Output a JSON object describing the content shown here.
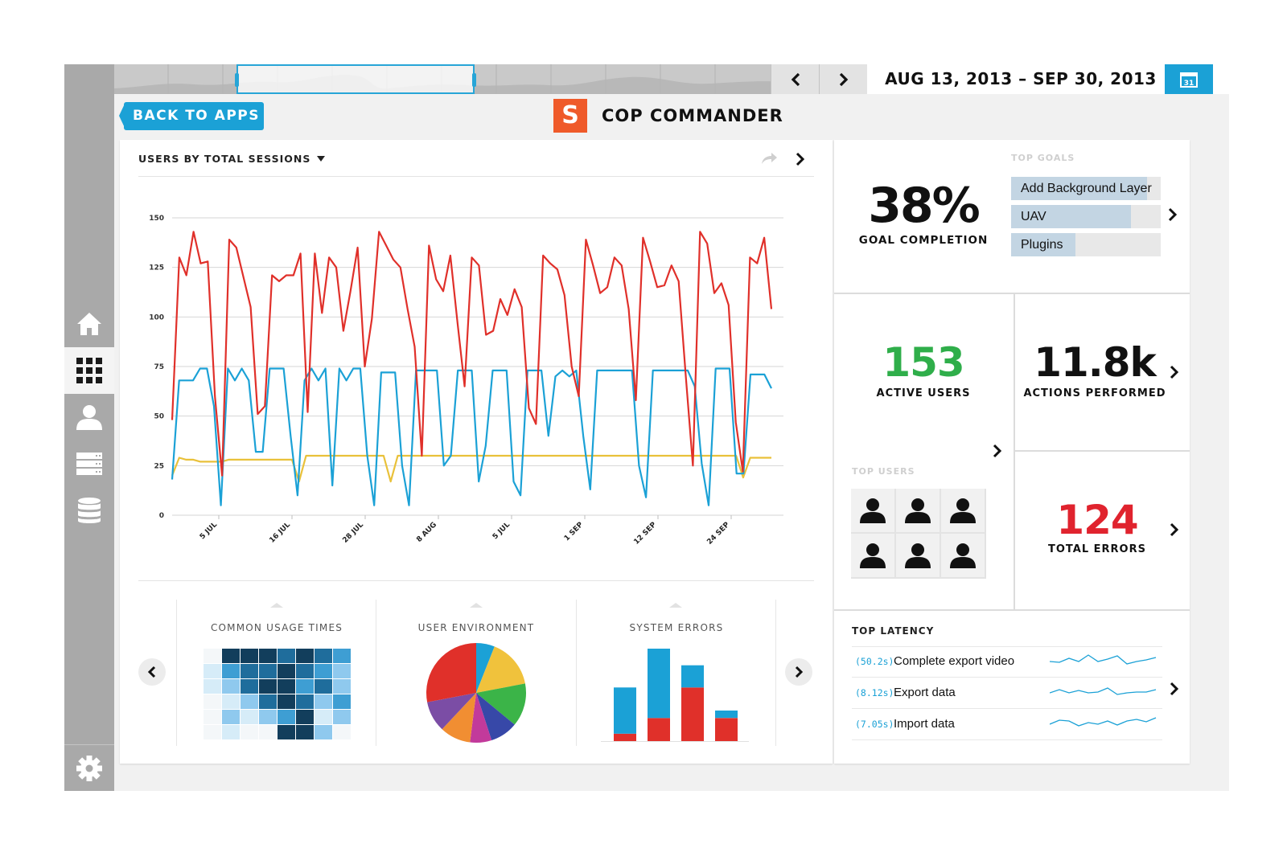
{
  "topbar": {
    "date_range": "AUG 13, 2013 – SEP 30, 2013",
    "calendar_day": "31"
  },
  "header": {
    "back_label": "BACK TO APPS",
    "app_logo_letter": "S",
    "app_title": "COP COMMANDER"
  },
  "sidebar": {
    "items": [
      {
        "icon": "home-icon"
      },
      {
        "icon": "grid-icon",
        "active": true
      },
      {
        "icon": "user-icon"
      },
      {
        "icon": "server-icon"
      },
      {
        "icon": "database-icon"
      }
    ],
    "settings_icon": "gear-icon"
  },
  "main_chart": {
    "title": "USERS BY TOTAL SESSIONS",
    "chart_data": {
      "type": "line",
      "y_ticks": [
        "150",
        "125",
        "100",
        "75",
        "50",
        "25",
        "0"
      ],
      "ylim": [
        0,
        150
      ],
      "x_tick_labels": [
        "5 JUL",
        "16 JUL",
        "28 JUL",
        "8 AUG",
        "5 JUL",
        "1 SEP",
        "12 SEP",
        "24 SEP"
      ],
      "grid": true,
      "colors": [
        "#e0302a",
        "#1ba1d6",
        "#e9c13a"
      ],
      "series": [
        {
          "values": [
            48,
            130,
            121,
            143,
            127,
            128,
            60,
            20,
            139,
            135,
            120,
            105,
            51,
            55,
            121,
            118,
            121,
            121,
            132,
            52,
            132,
            102,
            130,
            125,
            93,
            113,
            135,
            75,
            99,
            143,
            136,
            129,
            125,
            104,
            85,
            30,
            136,
            119,
            113,
            131,
            97,
            65,
            130,
            126,
            91,
            93,
            109,
            101,
            114,
            105,
            54,
            46,
            131,
            127,
            124,
            111,
            75,
            60,
            139,
            126,
            112,
            115,
            130,
            126,
            104,
            58,
            140,
            128,
            115,
            116,
            126,
            118,
            70,
            25,
            143,
            137,
            112,
            117,
            106,
            47,
            22,
            130,
            127,
            140,
            104
          ]
        },
        {
          "values": [
            18,
            68,
            68,
            68,
            74,
            74,
            55,
            5,
            74,
            68,
            74,
            68,
            32,
            32,
            74,
            74,
            74,
            40,
            10,
            68,
            74,
            68,
            74,
            15,
            74,
            68,
            74,
            74,
            30,
            5,
            72,
            72,
            72,
            25,
            5,
            73,
            73,
            73,
            73,
            25,
            30,
            73,
            73,
            73,
            17,
            35,
            73,
            73,
            73,
            17,
            10,
            73,
            73,
            73,
            40,
            70,
            73,
            70,
            73,
            40,
            13,
            73,
            73,
            73,
            73,
            73,
            73,
            25,
            9,
            73,
            73,
            73,
            73,
            73,
            73,
            65,
            26,
            5,
            74,
            74,
            74,
            21,
            21,
            71,
            71,
            71,
            64
          ]
        },
        {
          "values": [
            20,
            29,
            28,
            28,
            27,
            27,
            27,
            27,
            28,
            28,
            28,
            28,
            28,
            28,
            28,
            28,
            28,
            28,
            17,
            30,
            30,
            30,
            30,
            30,
            30,
            30,
            30,
            30,
            30,
            30,
            30,
            17,
            30,
            30,
            30,
            30,
            30,
            30,
            30,
            30,
            30,
            30,
            30,
            30,
            30,
            30,
            30,
            30,
            30,
            30,
            30,
            30,
            30,
            30,
            30,
            30,
            30,
            30,
            30,
            30,
            30,
            30,
            30,
            30,
            30,
            30,
            30,
            30,
            30,
            30,
            30,
            30,
            30,
            30,
            30,
            30,
            30,
            30,
            30,
            30,
            30,
            19,
            29,
            29,
            29,
            29
          ]
        }
      ]
    }
  },
  "mini_charts": {
    "usage_times": {
      "title": "COMMON USAGE TIMES",
      "chart_data": {
        "type": "heatmap",
        "rows": 6,
        "cols": 8,
        "values": [
          [
            0,
            5,
            5,
            5,
            4,
            5,
            4,
            3
          ],
          [
            1,
            3,
            4,
            4,
            5,
            4,
            3,
            2
          ],
          [
            1,
            2,
            4,
            5,
            5,
            3,
            4,
            2
          ],
          [
            0,
            1,
            2,
            4,
            5,
            4,
            2,
            3
          ],
          [
            0,
            2,
            1,
            2,
            3,
            5,
            1,
            2
          ],
          [
            0,
            1,
            0,
            0,
            5,
            5,
            2,
            0
          ]
        ],
        "scale": [
          "#f4f7f9",
          "#d6ecf8",
          "#8fc9ee",
          "#3e9ed3",
          "#1f6d9c",
          "#123e5c"
        ]
      }
    },
    "user_environment": {
      "title": "USER ENVIRONMENT",
      "chart_data": {
        "type": "pie",
        "values": [
          6,
          16,
          14,
          9,
          7,
          10,
          10,
          28
        ],
        "colors": [
          "#1ba1d6",
          "#f0c23c",
          "#3bb448",
          "#3748a8",
          "#c23a9b",
          "#f18e32",
          "#7b4da5",
          "#e0302a"
        ]
      }
    },
    "system_errors": {
      "title": "SYSTEM ERRORS",
      "chart_data": {
        "type": "bar",
        "stacked": true,
        "series": [
          {
            "color": "#e0302a",
            "values": [
              8,
              25,
              58,
              25
            ]
          },
          {
            "color": "#1ba1d6",
            "values": [
              50,
              75,
              24,
              8
            ]
          }
        ]
      }
    }
  },
  "right_panel": {
    "goal_completion": {
      "value": "38%",
      "label": "GOAL COMPLETION"
    },
    "top_goals": {
      "title": "TOP GOALS",
      "items": [
        {
          "label": "Add Background Layer",
          "fill": 0.91
        },
        {
          "label": "UAV",
          "fill": 0.8
        },
        {
          "label": "Plugins",
          "fill": 0.43
        }
      ]
    },
    "active_users": {
      "value": "153",
      "label": "ACTIVE USERS",
      "color": "#2fae4a"
    },
    "actions": {
      "value": "11.8k",
      "label": "ACTIONS PERFORMED",
      "color": "#111111"
    },
    "errors": {
      "value": "124",
      "label": "TOTAL ERRORS",
      "color": "#e0232e"
    },
    "top_users": {
      "title": "TOP USERS",
      "count": 6
    },
    "top_latency": {
      "title": "TOP LATENCY",
      "rows": [
        {
          "time": "(50.2s)",
          "name": "Complete export video"
        },
        {
          "time": "(8.12s)",
          "name": "Export data"
        },
        {
          "time": "(7.05s)",
          "name": "Import data"
        }
      ]
    }
  }
}
